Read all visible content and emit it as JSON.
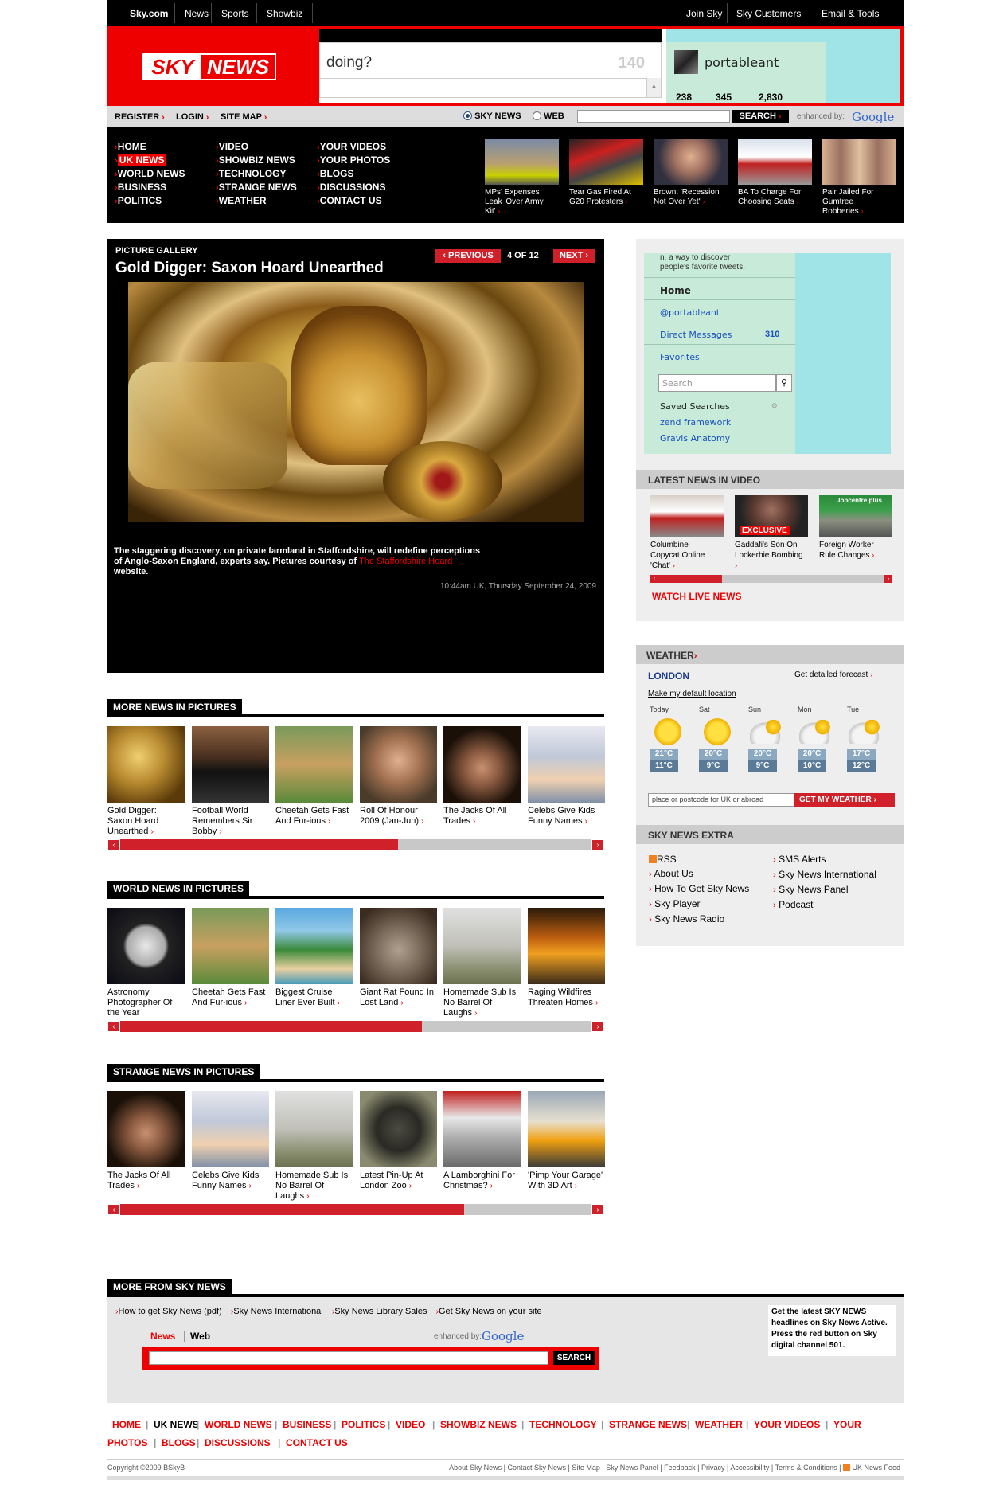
{
  "topbar": {
    "left": [
      "Sky.com",
      "News",
      "Sports",
      "Showbiz"
    ],
    "right": [
      "Join Sky",
      "Sky Customers",
      "Email & Tools"
    ]
  },
  "logo": {
    "sky": "SKY",
    "news": "NEWS"
  },
  "twitter": {
    "prompt": "doing?",
    "counter": "140",
    "username": "portableant",
    "stats": [
      "238",
      "345",
      "2,830"
    ]
  },
  "topnav": {
    "register": "REGISTER",
    "login": "LOGIN",
    "sitemap": "SITE MAP",
    "radio_sky": "SKY NEWS",
    "radio_web": "WEB",
    "search_btn": "SEARCH",
    "enhanced": "enhanced by:",
    "google": "Google"
  },
  "mega": {
    "col1": [
      "HOME",
      "UK NEWS",
      "WORLD NEWS",
      "BUSINESS",
      "POLITICS"
    ],
    "col2": [
      "VIDEO",
      "SHOWBIZ NEWS",
      "TECHNOLOGY",
      "STRANGE NEWS",
      "WEATHER"
    ],
    "col3": [
      "YOUR VIDEOS",
      "YOUR PHOTOS",
      "BLOGS",
      "DISCUSSIONS",
      "CONTACT US"
    ],
    "stories": [
      {
        "l1": "MPs' Expenses",
        "l2": "Leak 'Over Army",
        "l3": "Kit'"
      },
      {
        "l1": "Tear Gas Fired At",
        "l2": "G20 Protesters",
        "l3": ""
      },
      {
        "l1": "Brown: 'Recession",
        "l2": "Not Over Yet'",
        "l3": ""
      },
      {
        "l1": "BA To Charge For",
        "l2": "Choosing Seats",
        "l3": ""
      },
      {
        "l1": "Pair Jailed For",
        "l2": "Gumtree",
        "l3": "Robberies"
      }
    ]
  },
  "gallery": {
    "kicker": "PICTURE GALLERY",
    "title": "Gold Digger: Saxon Hoard Unearthed",
    "prev": "PREVIOUS",
    "count": "4 OF 12",
    "next": "NEXT",
    "caption_a": "The staggering discovery, on private farmland in Staffordshire, will redefine perceptions",
    "caption_b": "of Anglo-Saxon England, experts say. Pictures courtesy of",
    "caption_link": "The Staffordshire Hoard",
    "caption_c": "website.",
    "date": "10:44am UK, Thursday September 24, 2009"
  },
  "more": {
    "title": "MORE NEWS IN PICTURES",
    "items": [
      [
        "Gold Digger:",
        "Saxon Hoard",
        "Unearthed"
      ],
      [
        "Football World",
        "Remembers Sir",
        "Bobby"
      ],
      [
        "Cheetah Gets Fast",
        "And Fur-ious",
        ""
      ],
      [
        "Roll Of Honour",
        "2009 (Jan-Jun)",
        ""
      ],
      [
        "The Jacks Of All",
        "Trades",
        ""
      ],
      [
        "Celebs Give Kids",
        "Funny Names",
        ""
      ]
    ],
    "fill": 0.59
  },
  "world": {
    "title": "WORLD NEWS IN PICTURES",
    "items": [
      [
        "Astronomy",
        "Photographer Of",
        "the Year"
      ],
      [
        "Cheetah Gets Fast",
        "And Fur-ious",
        ""
      ],
      [
        "Biggest Cruise",
        "Liner Ever Built",
        ""
      ],
      [
        "Giant Rat Found In",
        "Lost Land",
        ""
      ],
      [
        "Homemade Sub Is",
        "No Barrel Of",
        "Laughs"
      ],
      [
        "Raging Wildfires",
        "Threaten Homes",
        ""
      ]
    ],
    "fill": 0.64
  },
  "strange": {
    "title": "STRANGE NEWS IN PICTURES",
    "items": [
      [
        "The Jacks Of All",
        "Trades",
        ""
      ],
      [
        "Celebs Give Kids",
        "Funny Names",
        ""
      ],
      [
        "Homemade Sub Is",
        "No Barrel Of",
        "Laughs"
      ],
      [
        "Latest Pin-Up At",
        "London Zoo",
        ""
      ],
      [
        "A Lamborghini For",
        "Christmas?",
        ""
      ],
      [
        "'Pimp Your Garage'",
        "With 3D Art",
        ""
      ]
    ],
    "fill": 0.73
  },
  "sidebar": {
    "tweets_text": "n. a way to discover",
    "tweets_text2": "people's favorite tweets.",
    "home": "Home",
    "user": "@portableant",
    "dm": "Direct Messages",
    "dm_count": "310",
    "fav": "Favorites",
    "search_ph": "Search",
    "saved": "Saved Searches",
    "zend": "zend framework",
    "grav": "Gravis Anatomy"
  },
  "video": {
    "title": "LATEST NEWS IN VIDEO",
    "items": [
      [
        "Columbine",
        "Copycat Online",
        "'Chat'"
      ],
      [
        "Gaddafi's Son On",
        "Lockerbie Bombing",
        ""
      ],
      [
        "Foreign Worker",
        "Rule Changes",
        ""
      ]
    ],
    "exclusive": "EXCLUSIVE",
    "jobcentre": "Jobcentre plus",
    "watch": "WATCH LIVE NEWS"
  },
  "weather": {
    "title": "WEATHER",
    "city": "LONDON",
    "forecast": "Get detailed forecast",
    "default": "Make my default location",
    "placeholder": "place or postcode for UK or abroad",
    "btn": "GET MY WEATHER",
    "days": [
      {
        "d": "Today",
        "hi": "21°C",
        "lo": "11°C",
        "t": "sun"
      },
      {
        "d": "Sat",
        "hi": "20°C",
        "lo": "9°C",
        "t": "sun"
      },
      {
        "d": "Sun",
        "hi": "20°C",
        "lo": "9°C",
        "t": "cloud"
      },
      {
        "d": "Mon",
        "hi": "20°C",
        "lo": "10°C",
        "t": "cloud"
      },
      {
        "d": "Tue",
        "hi": "17°C",
        "lo": "12°C",
        "t": "cloud"
      }
    ]
  },
  "extra": {
    "title": "SKY NEWS EXTRA",
    "left": [
      "RSS",
      "About Us",
      "How To Get Sky News",
      "Sky Player",
      "Sky News Radio"
    ],
    "right": [
      "SMS Alerts",
      "Sky News International",
      "Sky News Panel",
      "Podcast"
    ]
  },
  "morefrom": {
    "title": "MORE FROM SKY NEWS",
    "links": [
      "How to get Sky News (pdf)",
      "Sky News International",
      "Sky News Library Sales",
      "Get Sky News on your site"
    ],
    "promo": "Get the latest SKY NEWS headlines on Sky News Active. Press the red button on Sky digital channel 501.",
    "tab_news": "News",
    "tab_web": "Web",
    "enhanced": "enhanced by:",
    "google": "Google",
    "search": "SEARCH"
  },
  "footnav": [
    "HOME",
    "UK NEWS",
    "WORLD NEWS",
    "BUSINESS",
    "POLITICS",
    "VIDEO",
    "SHOWBIZ NEWS",
    "TECHNOLOGY",
    "STRANGE NEWS",
    "WEATHER",
    "YOUR VIDEOS",
    "YOUR",
    "PHOTOS",
    "BLOGS",
    "DISCUSSIONS",
    "CONTACT US"
  ],
  "copyright": "Copyright ©2009 BSkyB",
  "footlinks": [
    "About Sky News",
    "Contact Sky News",
    "Site Map",
    "Sky News Panel",
    "Feedback",
    "Privacy",
    "Accessibility",
    "Terms & Conditions",
    "UK News Feed"
  ],
  "colors": {
    "brand_red": "#e00000",
    "black": "#000000",
    "twitter_blue": "#a0e4e8"
  }
}
